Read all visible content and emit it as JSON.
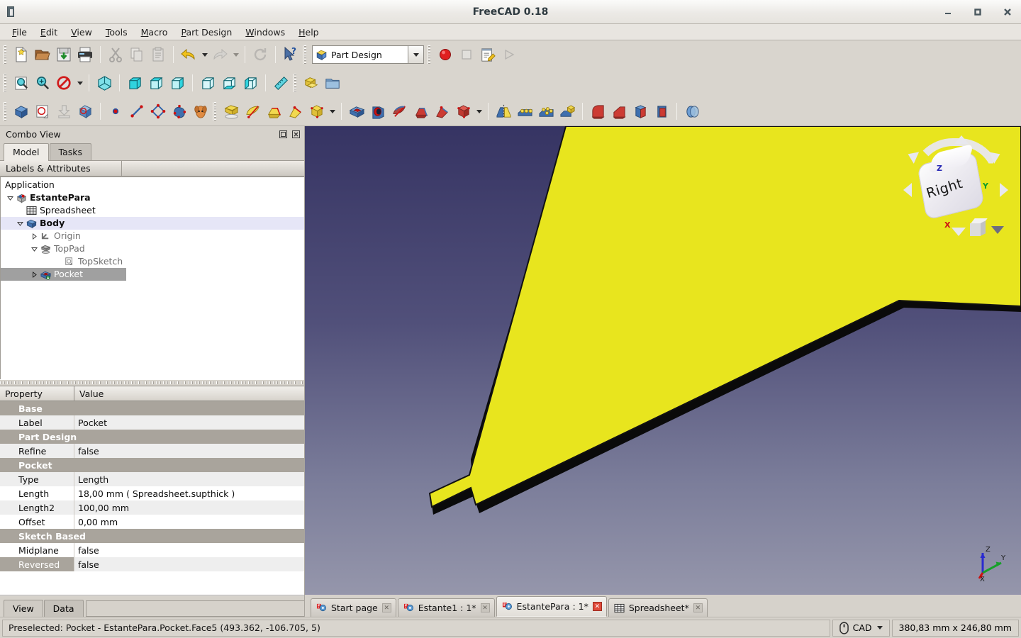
{
  "window": {
    "title": "FreeCAD 0.18",
    "app_icon": "freecad-app-icon",
    "minimize": "−",
    "maximize": "□",
    "close": "✕"
  },
  "menubar": {
    "items": [
      {
        "label": "File",
        "accel": "F"
      },
      {
        "label": "Edit",
        "accel": "E"
      },
      {
        "label": "View",
        "accel": "V"
      },
      {
        "label": "Tools",
        "accel": "T"
      },
      {
        "label": "Macro",
        "accel": "M"
      },
      {
        "label": "Part Design",
        "accel": "P"
      },
      {
        "label": "Windows",
        "accel": "W"
      },
      {
        "label": "Help",
        "accel": "H"
      }
    ]
  },
  "toolbars": {
    "file": [
      {
        "name": "new-document-icon",
        "label": "New"
      },
      {
        "name": "open-document-icon",
        "label": "Open"
      },
      {
        "name": "save-document-icon",
        "label": "Save"
      },
      {
        "name": "print-icon",
        "label": "Print"
      },
      {
        "name": "cut-icon",
        "label": "Cut"
      },
      {
        "name": "copy-icon",
        "label": "Copy"
      },
      {
        "name": "paste-icon",
        "label": "Paste"
      },
      {
        "name": "undo-icon",
        "label": "Undo"
      },
      {
        "name": "redo-icon",
        "label": "Redo"
      },
      {
        "name": "refresh-icon",
        "label": "Refresh"
      },
      {
        "name": "whats-this-icon",
        "label": "What's This"
      }
    ],
    "workbench": {
      "selected": "Part Design",
      "icon": "part-design-workbench-icon",
      "arrow": "chevron-down-icon"
    },
    "macro": [
      {
        "name": "macro-record-icon",
        "label": "Macro recording"
      },
      {
        "name": "macro-stop-icon",
        "label": "Stop macro recording"
      },
      {
        "name": "macro-edit-icon",
        "label": "Macros"
      },
      {
        "name": "macro-execute-icon",
        "label": "Execute macro"
      }
    ],
    "view": [
      {
        "name": "fit-all-icon",
        "label": "Fit all"
      },
      {
        "name": "fit-selection-icon",
        "label": "Fit selection"
      },
      {
        "name": "draw-style-icon",
        "label": "Draw style"
      },
      {
        "name": "axonometric-view-icon",
        "label": "Axonometric"
      },
      {
        "name": "front-view-icon",
        "label": "Front"
      },
      {
        "name": "top-view-icon",
        "label": "Top"
      },
      {
        "name": "right-view-icon",
        "label": "Right"
      },
      {
        "name": "rear-view-icon",
        "label": "Rear"
      },
      {
        "name": "bottom-view-icon",
        "label": "Bottom"
      },
      {
        "name": "left-view-icon",
        "label": "Left"
      },
      {
        "name": "measure-icon",
        "label": "Measure"
      }
    ],
    "structure": [
      {
        "name": "create-part-icon",
        "label": "Create part"
      },
      {
        "name": "create-group-icon",
        "label": "Create group"
      }
    ],
    "partdesign_helper": [
      {
        "name": "create-body-icon",
        "label": "Create body"
      },
      {
        "name": "create-sketch-icon",
        "label": "Create sketch"
      },
      {
        "name": "attach-sketch-icon",
        "label": "Attach sketch"
      },
      {
        "name": "validate-sketch-icon",
        "label": "Validate sketch"
      },
      {
        "name": "create-point-icon",
        "label": "Point"
      },
      {
        "name": "create-line-icon",
        "label": "Line"
      },
      {
        "name": "create-polyline-icon",
        "label": "Polyline"
      },
      {
        "name": "create-bspline-icon",
        "label": "B-spline"
      },
      {
        "name": "create-shape-binder-icon",
        "label": "Shape binder"
      }
    ],
    "additive": [
      {
        "name": "pad-icon",
        "label": "Pad"
      },
      {
        "name": "revolution-icon",
        "label": "Revolution"
      },
      {
        "name": "additive-loft-icon",
        "label": "Additive loft"
      },
      {
        "name": "additive-pipe-icon",
        "label": "Additive pipe"
      },
      {
        "name": "additive-primitive-icon",
        "label": "Additive primitive"
      }
    ],
    "subtractive": [
      {
        "name": "pocket-icon",
        "label": "Pocket"
      },
      {
        "name": "hole-icon",
        "label": "Hole"
      },
      {
        "name": "groove-icon",
        "label": "Groove"
      },
      {
        "name": "subtractive-loft-icon",
        "label": "Subtractive loft"
      },
      {
        "name": "subtractive-pipe-icon",
        "label": "Subtractive pipe"
      },
      {
        "name": "subtractive-primitive-icon",
        "label": "Subtractive primitive"
      }
    ],
    "transform": [
      {
        "name": "mirrored-icon",
        "label": "Mirrored"
      },
      {
        "name": "linear-pattern-icon",
        "label": "LinearPattern"
      },
      {
        "name": "polar-pattern-icon",
        "label": "PolarPattern"
      },
      {
        "name": "multi-transform-icon",
        "label": "MultiTransform"
      }
    ],
    "dressup": [
      {
        "name": "fillet-icon",
        "label": "Fillet"
      },
      {
        "name": "chamfer-icon",
        "label": "Chamfer"
      },
      {
        "name": "draft-icon",
        "label": "Draft"
      },
      {
        "name": "thickness-icon",
        "label": "Thickness"
      },
      {
        "name": "boolean-icon",
        "label": "Boolean operation"
      }
    ]
  },
  "combo_view": {
    "title": "Combo View",
    "float_button": "undock-icon",
    "close_button": "close-icon",
    "tabs": [
      {
        "label": "Model",
        "active": true
      },
      {
        "label": "Tasks",
        "active": false
      }
    ],
    "tree_header": "Labels & Attributes",
    "tree": [
      {
        "label": "Application",
        "level": 0,
        "icon": "",
        "arrow": "",
        "bold": false,
        "state": "normal"
      },
      {
        "label": "EstantePara",
        "level": 1,
        "icon": "document-icon",
        "arrow": "expanded",
        "bold": true,
        "state": "normal"
      },
      {
        "label": "Spreadsheet",
        "level": 2,
        "icon": "spreadsheet-icon",
        "arrow": "",
        "bold": false,
        "state": "normal"
      },
      {
        "label": "Body",
        "level": 2,
        "icon": "body-icon",
        "arrow": "expanded",
        "bold": true,
        "state": "body-highlight"
      },
      {
        "label": "Origin",
        "level": 3,
        "icon": "origin-icon",
        "arrow": "collapsed",
        "bold": false,
        "state": "dim"
      },
      {
        "label": "TopPad",
        "level": 3,
        "icon": "pad-icon",
        "arrow": "expanded",
        "bold": false,
        "state": "dim"
      },
      {
        "label": "TopSketch",
        "level": 4,
        "icon": "sketch-icon",
        "arrow": "",
        "bold": false,
        "state": "dim"
      },
      {
        "label": "Pocket",
        "level": 3,
        "icon": "pocket-icon",
        "arrow": "collapsed",
        "bold": false,
        "state": "selected"
      }
    ]
  },
  "property_editor": {
    "columns": [
      "Property",
      "Value"
    ],
    "rows": [
      {
        "type": "group",
        "name": "Base",
        "value": ""
      },
      {
        "type": "item",
        "name": "Label",
        "value": "Pocket",
        "shade": "alt"
      },
      {
        "type": "group",
        "name": "Part Design",
        "value": ""
      },
      {
        "type": "item",
        "name": "Refine",
        "value": "false",
        "shade": "alt"
      },
      {
        "type": "group",
        "name": "Pocket",
        "value": ""
      },
      {
        "type": "item",
        "name": "Type",
        "value": "Length",
        "shade": "alt"
      },
      {
        "type": "item",
        "name": "Length",
        "value": "18,00 mm  ( Spreadsheet.supthick )",
        "shade": "white"
      },
      {
        "type": "item",
        "name": "Length2",
        "value": "100,00 mm",
        "shade": "alt"
      },
      {
        "type": "item",
        "name": "Offset",
        "value": "0,00 mm",
        "shade": "white"
      },
      {
        "type": "group",
        "name": "Sketch Based",
        "value": ""
      },
      {
        "type": "item",
        "name": "Midplane",
        "value": "false",
        "shade": "white"
      },
      {
        "type": "item",
        "name": "Reversed",
        "value": "false",
        "shade": "alt",
        "name_highlight": true
      }
    ],
    "bottom_tabs": [
      {
        "label": "View",
        "active": true
      },
      {
        "label": "Data",
        "active": false
      }
    ]
  },
  "view3d": {
    "navigation_cube": {
      "face_label": "Right",
      "axis_labels": {
        "x": "X",
        "y": "Y",
        "z": "Z"
      },
      "home_caret": "chevron-down-icon"
    },
    "axis_cross": {
      "x": "X",
      "y": "Y",
      "z": "Z"
    },
    "background_top": "#363463",
    "background_bottom": "#9596ab",
    "model_highlight_color": "#e8e51e",
    "model_edge_color": "#0a0a0a"
  },
  "document_tabs": [
    {
      "label": "Start page",
      "icon": "freecad-doc-icon",
      "active": false,
      "close": "✕"
    },
    {
      "label": "Estante1 : 1*",
      "icon": "freecad-doc-icon",
      "active": false,
      "close": "✕"
    },
    {
      "label": "EstantePara : 1*",
      "icon": "freecad-doc-icon",
      "active": true,
      "close": "✕"
    },
    {
      "label": "Spreadsheet*",
      "icon": "spreadsheet-icon",
      "active": false,
      "close": "✕"
    }
  ],
  "statusbar": {
    "message": "Preselected: Pocket - EstantePara.Pocket.Face5 (493.362, -106.705, 5)",
    "navigation_style": "CAD",
    "navigation_icon": "mouse-icon",
    "navigation_caret": "chevron-down-icon",
    "dimensions": "380,83 mm x 246,80 mm"
  }
}
